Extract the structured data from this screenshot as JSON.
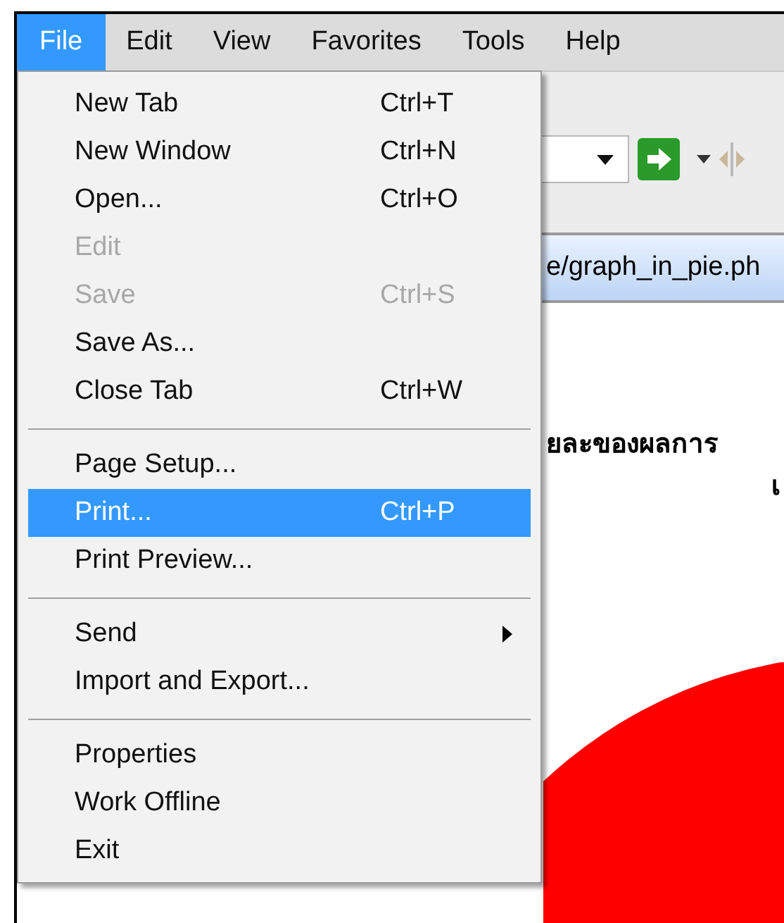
{
  "menu_bar": [
    {
      "label": "File",
      "selected": true
    },
    {
      "label": "Edit",
      "selected": false
    },
    {
      "label": "View",
      "selected": false
    },
    {
      "label": "Favorites",
      "selected": false
    },
    {
      "label": "Tools",
      "selected": false
    },
    {
      "label": "Help",
      "selected": false
    }
  ],
  "address_bar": {
    "text": "e/graph_in_pie.ph"
  },
  "page": {
    "heading_lines": [
      "ยละของผลการ",
      "เ"
    ]
  },
  "file_menu": {
    "items": [
      {
        "kind": "item",
        "label": "New Tab",
        "shortcut": "Ctrl+T",
        "disabled": false,
        "selected": false
      },
      {
        "kind": "item",
        "label": "New Window",
        "shortcut": "Ctrl+N",
        "disabled": false,
        "selected": false
      },
      {
        "kind": "item",
        "label": "Open...",
        "shortcut": "Ctrl+O",
        "disabled": false,
        "selected": false
      },
      {
        "kind": "item",
        "label": "Edit",
        "disabled": true,
        "selected": false
      },
      {
        "kind": "item",
        "label": "Save",
        "shortcut": "Ctrl+S",
        "disabled": true,
        "selected": false
      },
      {
        "kind": "item",
        "label": "Save As...",
        "disabled": false,
        "selected": false
      },
      {
        "kind": "item",
        "label": "Close Tab",
        "shortcut": "Ctrl+W",
        "disabled": false,
        "selected": false
      },
      {
        "kind": "separator"
      },
      {
        "kind": "item",
        "label": "Page Setup...",
        "disabled": false,
        "selected": false
      },
      {
        "kind": "item",
        "label": "Print...",
        "shortcut": "Ctrl+P",
        "disabled": false,
        "selected": true
      },
      {
        "kind": "item",
        "label": "Print Preview...",
        "disabled": false,
        "selected": false
      },
      {
        "kind": "separator"
      },
      {
        "kind": "item",
        "label": "Send",
        "disabled": false,
        "selected": false,
        "submenu": true
      },
      {
        "kind": "item",
        "label": "Import and Export...",
        "disabled": false,
        "selected": false
      },
      {
        "kind": "separator"
      },
      {
        "kind": "item",
        "label": "Properties",
        "disabled": false,
        "selected": false
      },
      {
        "kind": "item",
        "label": "Work Offline",
        "disabled": false,
        "selected": false
      },
      {
        "kind": "item",
        "label": "Exit",
        "disabled": false,
        "selected": false
      }
    ]
  }
}
